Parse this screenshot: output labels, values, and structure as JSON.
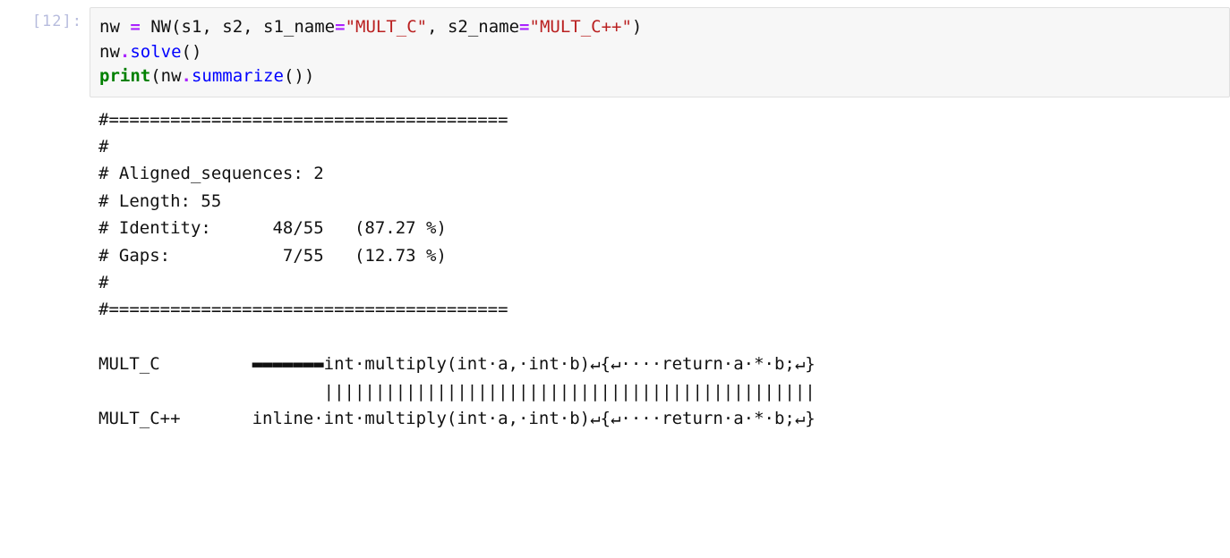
{
  "cell": {
    "prompt": "[12]:",
    "code": {
      "l1_a": "nw ",
      "l1_op": "=",
      "l1_b": " NW(s1, s2, s1_name",
      "l1_op2": "=",
      "l1_s1": "\"MULT_C\"",
      "l1_c": ", s2_name",
      "l1_op3": "=",
      "l1_s2": "\"MULT_C++\"",
      "l1_d": ")",
      "l2_a": "nw",
      "l2_op": ".",
      "l2_fn": "solve",
      "l2_b": "()",
      "l3_kw": "print",
      "l3_a": "(nw",
      "l3_op": ".",
      "l3_fn": "summarize",
      "l3_b": "())"
    },
    "output": "#=======================================\n#\n# Aligned_sequences: 2\n# Length: 55\n# Identity:      48/55   (87.27 %)\n# Gaps:           7/55   (12.73 %)\n#\n#=======================================\n\nMULT_C         ▬▬▬▬▬▬▬int·multiply(int·a,·int·b)↵{↵····return·a·*·b;↵}\n                      ||||||||||||||||||||||||||||||||||||||||||||||||\nMULT_C++       inline·int·multiply(int·a,·int·b)↵{↵····return·a·*·b;↵}"
  },
  "chart_data": {
    "type": "table",
    "title": "Needleman-Wunsch alignment summary",
    "rows": [
      {
        "metric": "Aligned_sequences",
        "value": 2
      },
      {
        "metric": "Length",
        "value": 55
      },
      {
        "metric": "Identity",
        "fraction": "48/55",
        "percent": 87.27
      },
      {
        "metric": "Gaps",
        "fraction": "7/55",
        "percent": 12.73
      }
    ],
    "sequences": [
      {
        "name": "MULT_C",
        "aligned": "-------int·multiply(int·a,·int·b)↵{↵····return·a·*·b;↵}"
      },
      {
        "name": "MULT_C++",
        "aligned": "inline·int·multiply(int·a,·int·b)↵{↵····return·a·*·b;↵}"
      }
    ]
  }
}
